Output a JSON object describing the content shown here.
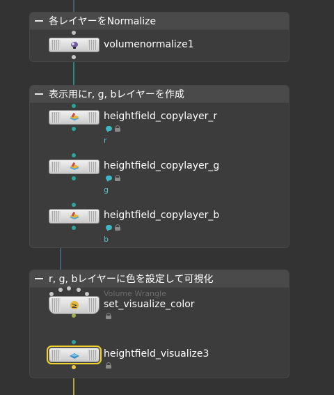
{
  "colors": {
    "background": "#333333",
    "netbox_background": "#3c3c3c",
    "wire_gray": "#c9c9c9",
    "wire_teal": "#2aa69c",
    "wire_blue": "#4d8fb8",
    "wire_yellow": "#e8c93c",
    "wire_olive": "#8c9a48",
    "selection": "#f2d12a",
    "layer_label": "#57c2c9"
  },
  "netboxes": [
    {
      "title": "各レイヤーをNormalize"
    },
    {
      "title": "表示用にr, g, bレイヤーを作成"
    },
    {
      "title": "r, g, bレイヤーに色を設定して可視化"
    }
  ],
  "nodes": {
    "volumenormalize": {
      "name": "volumenormalize1",
      "icon": "volume-normalize-icon"
    },
    "copylayer_r": {
      "name": "heightfield_copylayer_r",
      "label": "r",
      "icon": "heightfield-layer-icon"
    },
    "copylayer_g": {
      "name": "heightfield_copylayer_g",
      "label": "g",
      "icon": "heightfield-layer-icon"
    },
    "copylayer_b": {
      "name": "heightfield_copylayer_b",
      "label": "b",
      "icon": "heightfield-layer-icon"
    },
    "wrangle": {
      "type_label": "Volume Wrangle",
      "name": "set_visualize_color",
      "icon": "wrangle-icon"
    },
    "visualize": {
      "name": "heightfield_visualize3",
      "icon": "heightfield-visualize-icon",
      "selected": true
    }
  }
}
